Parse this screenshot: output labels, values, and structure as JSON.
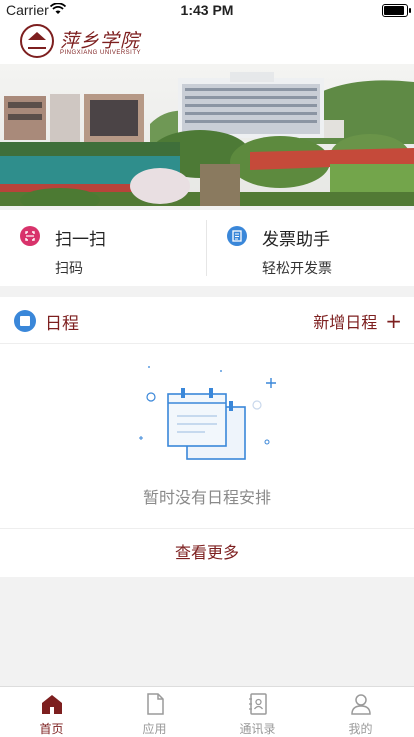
{
  "status_bar": {
    "carrier": "Carrier",
    "time": "1:43 PM",
    "battery_level": 1.0
  },
  "header": {
    "school_name": "萍乡学院",
    "school_name_en": "PINGXIANG UNIVERSITY"
  },
  "quick_actions": [
    {
      "title": "扫一扫",
      "subtitle": "扫码",
      "icon": "scan-icon",
      "color": "#d8336b"
    },
    {
      "title": "发票助手",
      "subtitle": "轻松开发票",
      "icon": "invoice-icon",
      "color": "#3a87d9"
    }
  ],
  "schedule": {
    "title": "日程",
    "add_label": "新增日程",
    "add_symbol": "+",
    "empty_text": "暂时没有日程安排",
    "view_more": "查看更多"
  },
  "tabs": [
    {
      "label": "首页",
      "icon": "home-icon",
      "active": true
    },
    {
      "label": "应用",
      "icon": "apps-icon",
      "active": false
    },
    {
      "label": "通讯录",
      "icon": "contacts-icon",
      "active": false
    },
    {
      "label": "我的",
      "icon": "profile-icon",
      "active": false
    }
  ],
  "colors": {
    "brand": "#7d1f1f",
    "scan": "#d8336b",
    "blue": "#3a87d9",
    "inactive": "#9a9a9a"
  }
}
